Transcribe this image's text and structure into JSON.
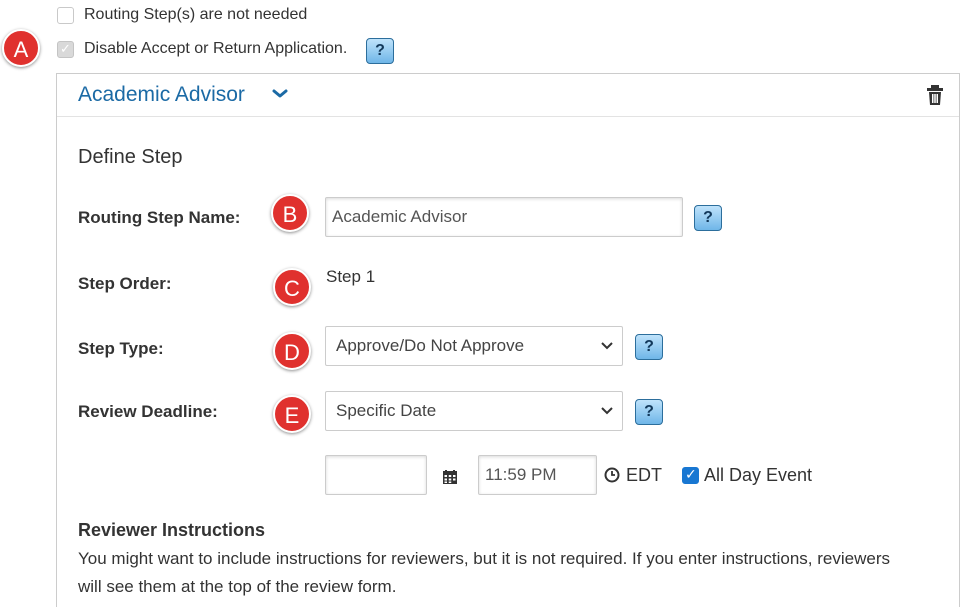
{
  "options": {
    "routing_not_needed": {
      "label": "Routing Step(s) are not needed",
      "checked": false
    },
    "disable_accept_return": {
      "label": "Disable Accept or Return Application.",
      "checked": true
    }
  },
  "help_label": "?",
  "markers": {
    "a": "A",
    "b": "B",
    "c": "C",
    "d": "D",
    "e": "E"
  },
  "panel": {
    "title": "Academic Advisor",
    "section_title": "Define Step",
    "routing_step_name": {
      "label": "Routing Step Name:",
      "value": "Academic Advisor"
    },
    "step_order": {
      "label": "Step Order:",
      "value": "Step 1"
    },
    "step_type": {
      "label": "Step Type:",
      "value": "Approve/Do Not Approve"
    },
    "review_deadline": {
      "label": "Review Deadline:",
      "value": "Specific Date",
      "date": "",
      "time": "11:59 PM",
      "timezone": "EDT",
      "all_day_label": "All Day Event",
      "all_day_checked": true
    },
    "reviewer_instructions": {
      "title": "Reviewer Instructions",
      "line1": "You might want to include instructions for reviewers, but it is not required. If you enter instructions, reviewers",
      "line2": "will see them at the top of the review form."
    }
  },
  "colors": {
    "accent": "#1b6aa5",
    "marker": "#e0312e",
    "checkbox_blue": "#1877d2"
  }
}
